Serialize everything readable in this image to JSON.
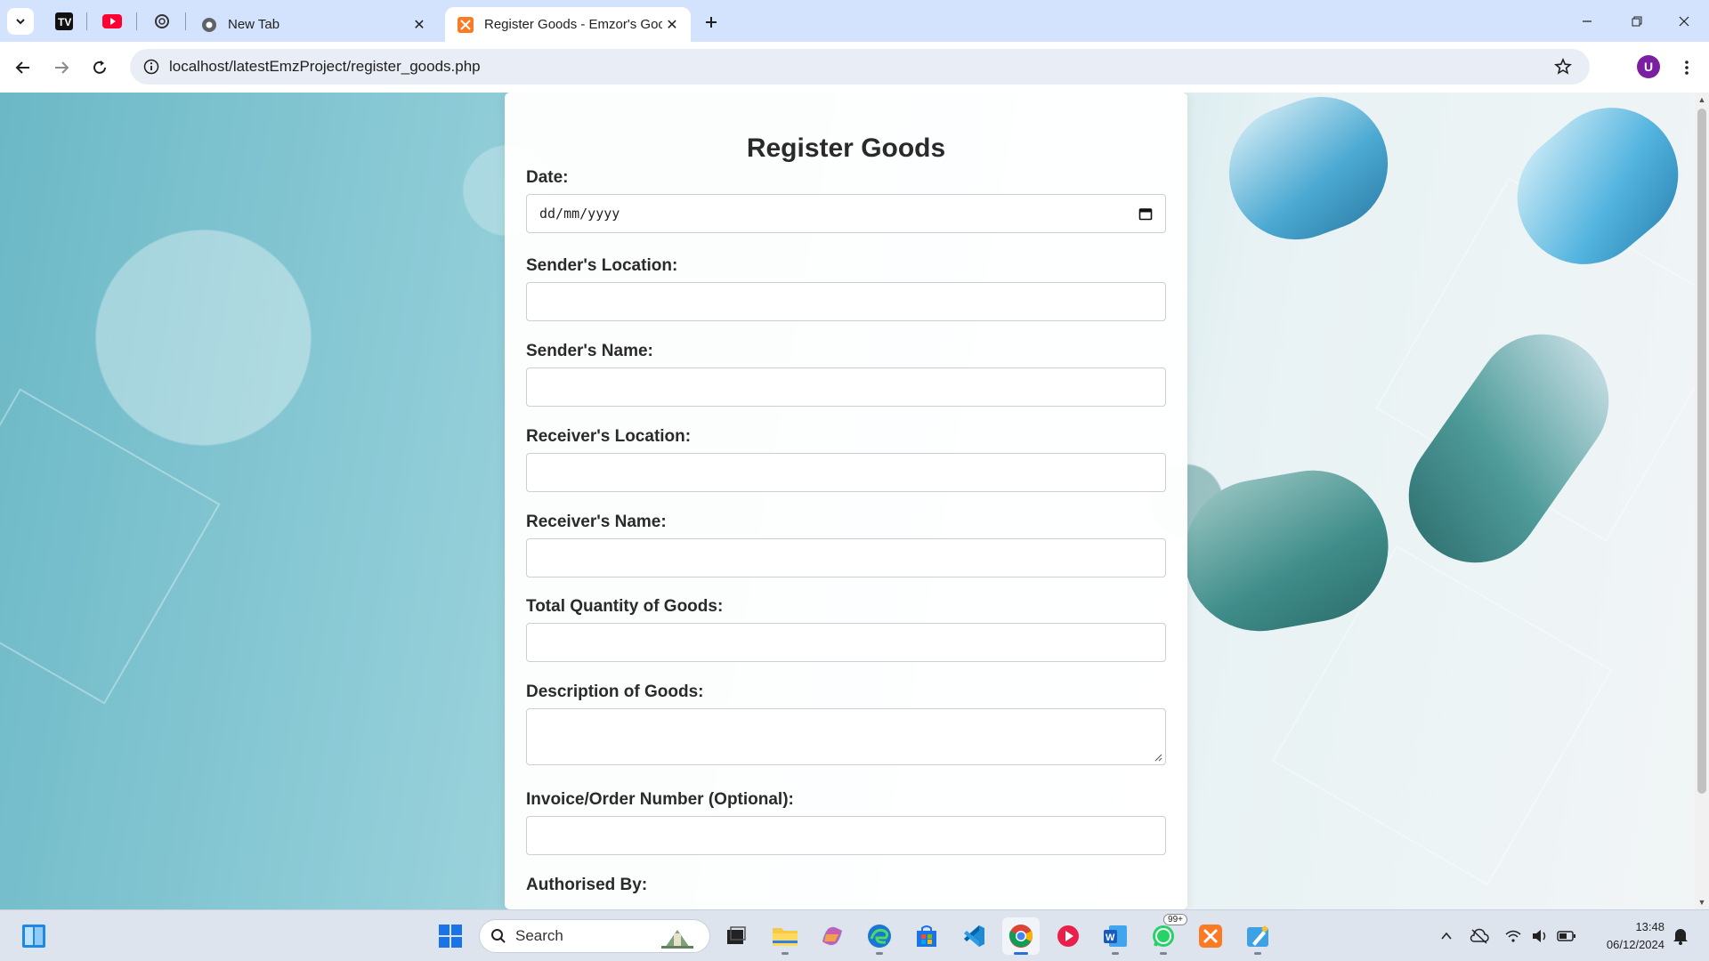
{
  "browser": {
    "tabs": [
      {
        "title": "New Tab",
        "icon": "chrome-icon"
      },
      {
        "title": "Register Goods - Emzor's Good",
        "icon": "xampp-icon",
        "active": true
      }
    ],
    "url": "localhost/latestEmzProject/register_goods.php",
    "profile_initial": "U"
  },
  "form": {
    "title": "Register Goods",
    "fields": [
      {
        "label": "Date:",
        "type": "date",
        "placeholder": "dd/mm/yyyy"
      },
      {
        "label": "Sender's Location:",
        "type": "text",
        "value": ""
      },
      {
        "label": "Sender's Name:",
        "type": "text",
        "value": ""
      },
      {
        "label": "Receiver's Location:",
        "type": "text",
        "value": ""
      },
      {
        "label": "Receiver's Name:",
        "type": "text",
        "value": ""
      },
      {
        "label": "Total Quantity of Goods:",
        "type": "text",
        "value": ""
      },
      {
        "label": "Description of Goods:",
        "type": "textarea",
        "value": ""
      },
      {
        "label": "Invoice/Order Number (Optional):",
        "type": "text",
        "value": ""
      },
      {
        "label": "Authorised By:",
        "type": "text",
        "value": ""
      }
    ]
  },
  "taskbar": {
    "search_label": "Search",
    "whatsapp_badge": "99+",
    "clock_time": "13:48",
    "clock_date": "06/12/2024"
  },
  "colors": {
    "tab_strip": "#d3e3fd",
    "accent": "#2b6fd6",
    "avatar": "#7b1fa2"
  }
}
